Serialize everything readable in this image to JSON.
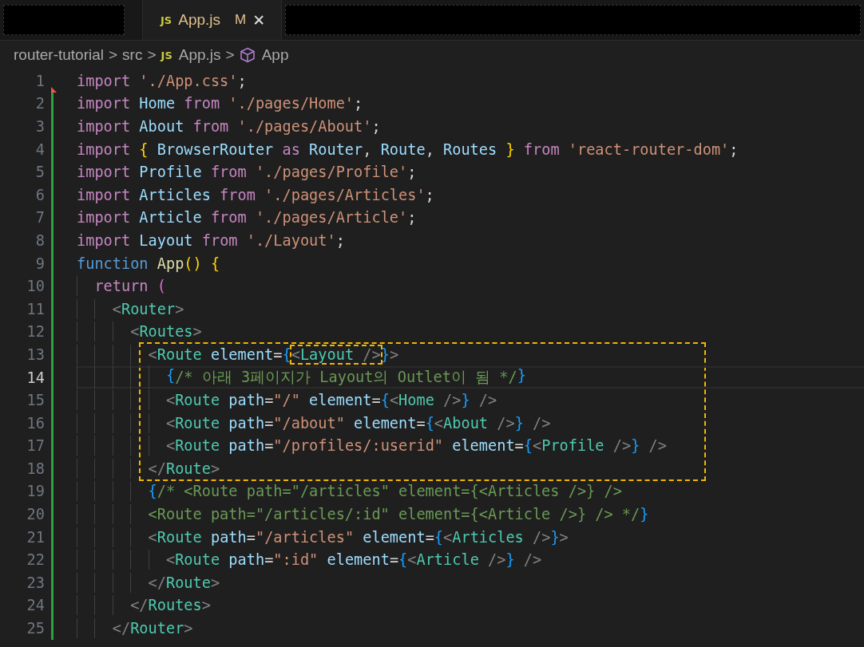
{
  "tabs": [
    {
      "kind": "redacted"
    },
    {
      "kind": "file",
      "icon_text": "JS",
      "label": "App.js",
      "badge": "M",
      "close": "✕",
      "selected": true
    },
    {
      "kind": "redacted"
    }
  ],
  "breadcrumb": [
    {
      "kind": "folder",
      "label": "router-tutorial"
    },
    {
      "kind": "folder",
      "label": "src"
    },
    {
      "kind": "file",
      "icon_text": "JS",
      "label": "App.js"
    },
    {
      "kind": "symbol",
      "label": "App"
    }
  ],
  "separator": ">",
  "blocks": [
    {
      "lines": [
        {
          "number": "1",
          "deletion_marker": true,
          "tokens": [
            {
              "kind": "kw",
              "text": "import"
            },
            {
              "kind": "str",
              "text": " './App.css'"
            },
            {
              "kind": "p",
              "text": ";"
            }
          ]
        },
        {
          "number": "2",
          "added": true,
          "tokens": [
            {
              "kind": "kw",
              "text": "import"
            },
            {
              "kind": "var",
              "text": " Home"
            },
            {
              "kind": "kw",
              "text": " from"
            },
            {
              "kind": "str",
              "text": " './pages/Home'"
            },
            {
              "kind": "p",
              "text": ";"
            }
          ]
        },
        {
          "number": "3",
          "added": true,
          "tokens": [
            {
              "kind": "kw",
              "text": "import"
            },
            {
              "kind": "var",
              "text": " About"
            },
            {
              "kind": "kw",
              "text": " from"
            },
            {
              "kind": "str",
              "text": " './pages/About'"
            },
            {
              "kind": "p",
              "text": ";"
            }
          ]
        },
        {
          "number": "4",
          "added": true,
          "tokens": [
            {
              "kind": "kw",
              "text": "import"
            },
            {
              "kind": "b1",
              "text": " {"
            },
            {
              "kind": "var",
              "text": " BrowserRouter"
            },
            {
              "kind": "kw",
              "text": " as"
            },
            {
              "kind": "var",
              "text": " Router"
            },
            {
              "kind": "p",
              "text": ","
            },
            {
              "kind": "var",
              "text": " Route"
            },
            {
              "kind": "p",
              "text": ","
            },
            {
              "kind": "var",
              "text": " Routes"
            },
            {
              "kind": "b1",
              "text": " }"
            },
            {
              "kind": "kw",
              "text": " from"
            },
            {
              "kind": "str",
              "text": " 'react-router-dom'"
            },
            {
              "kind": "p",
              "text": ";"
            }
          ]
        },
        {
          "number": "5",
          "added": true,
          "tokens": [
            {
              "kind": "kw",
              "text": "import"
            },
            {
              "kind": "var",
              "text": " Profile"
            },
            {
              "kind": "kw",
              "text": " from"
            },
            {
              "kind": "str",
              "text": " './pages/Profile'"
            },
            {
              "kind": "p",
              "text": ";"
            }
          ]
        },
        {
          "number": "6",
          "added": true,
          "tokens": [
            {
              "kind": "kw",
              "text": "import"
            },
            {
              "kind": "var",
              "text": " Articles"
            },
            {
              "kind": "kw",
              "text": " from"
            },
            {
              "kind": "str",
              "text": " './pages/Articles'"
            },
            {
              "kind": "p",
              "text": ";"
            }
          ]
        },
        {
          "number": "7",
          "added": true,
          "tokens": [
            {
              "kind": "kw",
              "text": "import"
            },
            {
              "kind": "var",
              "text": " Article"
            },
            {
              "kind": "kw",
              "text": " from"
            },
            {
              "kind": "str",
              "text": " './pages/Article'"
            },
            {
              "kind": "p",
              "text": ";"
            }
          ]
        },
        {
          "number": "8",
          "added": true,
          "tokens": [
            {
              "kind": "kw",
              "text": "import"
            },
            {
              "kind": "var",
              "text": " Layout"
            },
            {
              "kind": "kw",
              "text": " from"
            },
            {
              "kind": "str",
              "text": " './Layout'"
            },
            {
              "kind": "p",
              "text": ";"
            }
          ]
        },
        {
          "number": "9",
          "added": true,
          "tokens": [
            {
              "kind": "storage",
              "text": "function"
            },
            {
              "kind": "fn",
              "text": " App"
            },
            {
              "kind": "b1",
              "text": "()"
            },
            {
              "kind": "b1",
              "text": " {"
            }
          ]
        },
        {
          "number": "10",
          "added": true,
          "tokens": [
            {
              "kind": "kw",
              "text": "  return"
            },
            {
              "kind": "b2",
              "text": " ("
            }
          ]
        },
        {
          "number": "11",
          "added": true,
          "tokens": [
            {
              "kind": "angle",
              "text": "    <"
            },
            {
              "kind": "tag",
              "text": "Router"
            },
            {
              "kind": "angle",
              "text": ">"
            }
          ]
        },
        {
          "number": "12",
          "added": true,
          "tokens": [
            {
              "kind": "angle",
              "text": "      <"
            },
            {
              "kind": "tag",
              "text": "Routes"
            },
            {
              "kind": "angle",
              "text": ">"
            }
          ]
        }
      ]
    },
    {
      "highlighted": true,
      "lines": [
        {
          "number": "13",
          "added": true,
          "tokens": [
            {
              "kind": "angle",
              "text": "        <"
            },
            {
              "kind": "tag",
              "text": "Route"
            },
            {
              "kind": "attr",
              "text": " element"
            },
            {
              "kind": "p",
              "text": "="
            },
            {
              "kind": "b3",
              "text": "{"
            },
            {
              "kind": "angle",
              "text": "<",
              "boxed": true
            },
            {
              "kind": "tag",
              "text": "Layout",
              "boxed": true
            },
            {
              "kind": "angle",
              "text": " />",
              "boxed": true
            },
            {
              "kind": "b3",
              "text": "}"
            },
            {
              "kind": "angle",
              "text": ">"
            }
          ]
        },
        {
          "number": "14",
          "added": true,
          "current": true,
          "tokens": [
            {
              "kind": "b3",
              "text": "          {"
            },
            {
              "kind": "cm",
              "text": "/* 아래 3페이지가 Layout의 Outlet이 됨 */"
            },
            {
              "kind": "b3",
              "text": "}"
            }
          ]
        },
        {
          "number": "15",
          "added": true,
          "tokens": [
            {
              "kind": "angle",
              "text": "          <"
            },
            {
              "kind": "tag",
              "text": "Route"
            },
            {
              "kind": "attr",
              "text": " path"
            },
            {
              "kind": "p",
              "text": "="
            },
            {
              "kind": "str",
              "text": "\"/\""
            },
            {
              "kind": "attr",
              "text": " element"
            },
            {
              "kind": "p",
              "text": "="
            },
            {
              "kind": "b3",
              "text": "{"
            },
            {
              "kind": "angle",
              "text": "<"
            },
            {
              "kind": "tag",
              "text": "Home"
            },
            {
              "kind": "angle",
              "text": " />"
            },
            {
              "kind": "b3",
              "text": "}"
            },
            {
              "kind": "angle",
              "text": " />"
            }
          ]
        },
        {
          "number": "16",
          "added": true,
          "tokens": [
            {
              "kind": "angle",
              "text": "          <"
            },
            {
              "kind": "tag",
              "text": "Route"
            },
            {
              "kind": "attr",
              "text": " path"
            },
            {
              "kind": "p",
              "text": "="
            },
            {
              "kind": "str",
              "text": "\"/about\""
            },
            {
              "kind": "attr",
              "text": " element"
            },
            {
              "kind": "p",
              "text": "="
            },
            {
              "kind": "b3",
              "text": "{"
            },
            {
              "kind": "angle",
              "text": "<"
            },
            {
              "kind": "tag",
              "text": "About"
            },
            {
              "kind": "angle",
              "text": " />"
            },
            {
              "kind": "b3",
              "text": "}"
            },
            {
              "kind": "angle",
              "text": " />"
            }
          ]
        },
        {
          "number": "17",
          "added": true,
          "tokens": [
            {
              "kind": "angle",
              "text": "          <"
            },
            {
              "kind": "tag",
              "text": "Route"
            },
            {
              "kind": "attr",
              "text": " path"
            },
            {
              "kind": "p",
              "text": "="
            },
            {
              "kind": "str",
              "text": "\"/profiles/:userid\""
            },
            {
              "kind": "attr",
              "text": " element"
            },
            {
              "kind": "p",
              "text": "="
            },
            {
              "kind": "b3",
              "text": "{"
            },
            {
              "kind": "angle",
              "text": "<"
            },
            {
              "kind": "tag",
              "text": "Profile"
            },
            {
              "kind": "angle",
              "text": " />"
            },
            {
              "kind": "b3",
              "text": "}"
            },
            {
              "kind": "angle",
              "text": " />"
            }
          ]
        },
        {
          "number": "18",
          "added": true,
          "tokens": [
            {
              "kind": "angle",
              "text": "        </"
            },
            {
              "kind": "tag",
              "text": "Route"
            },
            {
              "kind": "angle",
              "text": ">"
            }
          ]
        }
      ]
    },
    {
      "lines": [
        {
          "number": "19",
          "added": true,
          "tokens": [
            {
              "kind": "b3",
              "text": "        {"
            },
            {
              "kind": "cm",
              "text": "/* <Route path=\"/articles\" element={<Articles />} />"
            }
          ]
        },
        {
          "number": "20",
          "added": true,
          "tokens": [
            {
              "kind": "cm",
              "text": "        <Route path=\"/articles/:id\" element={<Article />} /> */"
            },
            {
              "kind": "b3",
              "text": "}"
            }
          ]
        },
        {
          "number": "21",
          "added": true,
          "tokens": [
            {
              "kind": "angle",
              "text": "        <"
            },
            {
              "kind": "tag",
              "text": "Route"
            },
            {
              "kind": "attr",
              "text": " path"
            },
            {
              "kind": "p",
              "text": "="
            },
            {
              "kind": "str",
              "text": "\"/articles\""
            },
            {
              "kind": "attr",
              "text": " element"
            },
            {
              "kind": "p",
              "text": "="
            },
            {
              "kind": "b3",
              "text": "{"
            },
            {
              "kind": "angle",
              "text": "<"
            },
            {
              "kind": "tag",
              "text": "Articles"
            },
            {
              "kind": "angle",
              "text": " />"
            },
            {
              "kind": "b3",
              "text": "}"
            },
            {
              "kind": "angle",
              "text": ">"
            }
          ]
        },
        {
          "number": "22",
          "added": true,
          "tokens": [
            {
              "kind": "angle",
              "text": "          <"
            },
            {
              "kind": "tag",
              "text": "Route"
            },
            {
              "kind": "attr",
              "text": " path"
            },
            {
              "kind": "p",
              "text": "="
            },
            {
              "kind": "str",
              "text": "\":id\""
            },
            {
              "kind": "attr",
              "text": " element"
            },
            {
              "kind": "p",
              "text": "="
            },
            {
              "kind": "b3",
              "text": "{"
            },
            {
              "kind": "angle",
              "text": "<"
            },
            {
              "kind": "tag",
              "text": "Article"
            },
            {
              "kind": "angle",
              "text": " />"
            },
            {
              "kind": "b3",
              "text": "}"
            },
            {
              "kind": "angle",
              "text": " />"
            }
          ]
        },
        {
          "number": "23",
          "added": true,
          "tokens": [
            {
              "kind": "angle",
              "text": "        </"
            },
            {
              "kind": "tag",
              "text": "Route"
            },
            {
              "kind": "angle",
              "text": ">"
            }
          ]
        },
        {
          "number": "24",
          "added": true,
          "tokens": [
            {
              "kind": "angle",
              "text": "      </"
            },
            {
              "kind": "tag",
              "text": "Routes"
            },
            {
              "kind": "angle",
              "text": ">"
            }
          ]
        },
        {
          "number": "25",
          "added": true,
          "tokens": [
            {
              "kind": "angle",
              "text": "    </"
            },
            {
              "kind": "tag",
              "text": "Router"
            },
            {
              "kind": "angle",
              "text": ">"
            }
          ]
        }
      ]
    }
  ]
}
